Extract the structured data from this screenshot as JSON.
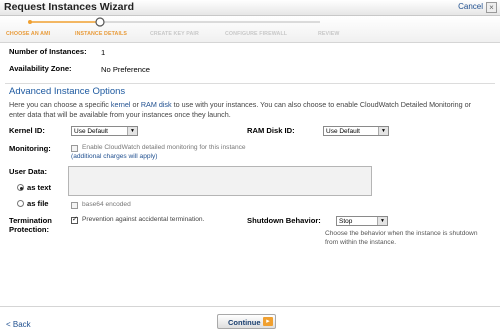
{
  "window": {
    "title": "Request Instances Wizard",
    "cancel_label": "Cancel",
    "close_glyph": "×"
  },
  "steps": [
    {
      "label": "CHOOSE AN AMI",
      "state": "done"
    },
    {
      "label": "INSTANCE DETAILS",
      "state": "current"
    },
    {
      "label": "CREATE KEY PAIR",
      "state": "todo"
    },
    {
      "label": "CONFIGURE FIREWALL",
      "state": "todo"
    },
    {
      "label": "REVIEW",
      "state": "todo"
    }
  ],
  "summary": {
    "instances_label": "Number of Instances:",
    "instances_value": "1",
    "zone_label": "Availability Zone:",
    "zone_value": "No Preference"
  },
  "advanced": {
    "title": "Advanced Instance Options",
    "desc_part1": "Here you can choose a specific ",
    "desc_link1": "kernel",
    "desc_part2": " or ",
    "desc_link2": "RAM disk",
    "desc_part3": " to use with your instances. You can also choose to enable CloudWatch Detailed Monitoring or enter data that will be available from your instances once they launch.",
    "kernel_label": "Kernel ID:",
    "kernel_value": "Use Default",
    "ramdisk_label": "RAM Disk ID:",
    "ramdisk_value": "Use Default",
    "monitoring_label": "Monitoring:",
    "monitoring_text": "Enable CloudWatch detailed monitoring for this instance",
    "monitoring_charges": "(additional charges will apply)",
    "userdata_label": "User Data:",
    "as_text_label": "as text",
    "as_file_label": "as file",
    "base64_label": "base64 encoded",
    "termination_label_1": "Termination",
    "termination_label_2": "Protection:",
    "termination_text": "Prevention against accidental termination.",
    "shutdown_label": "Shutdown Behavior:",
    "shutdown_value": "Stop",
    "shutdown_help": "Choose the behavior when the instance is shutdown from within the instance."
  },
  "footer": {
    "back_label": "< Back",
    "continue_label": "Continue"
  },
  "colors": {
    "accent_orange": "#f0a030",
    "link_blue": "#1f4f8f",
    "section_blue": "#1e5aa0"
  }
}
